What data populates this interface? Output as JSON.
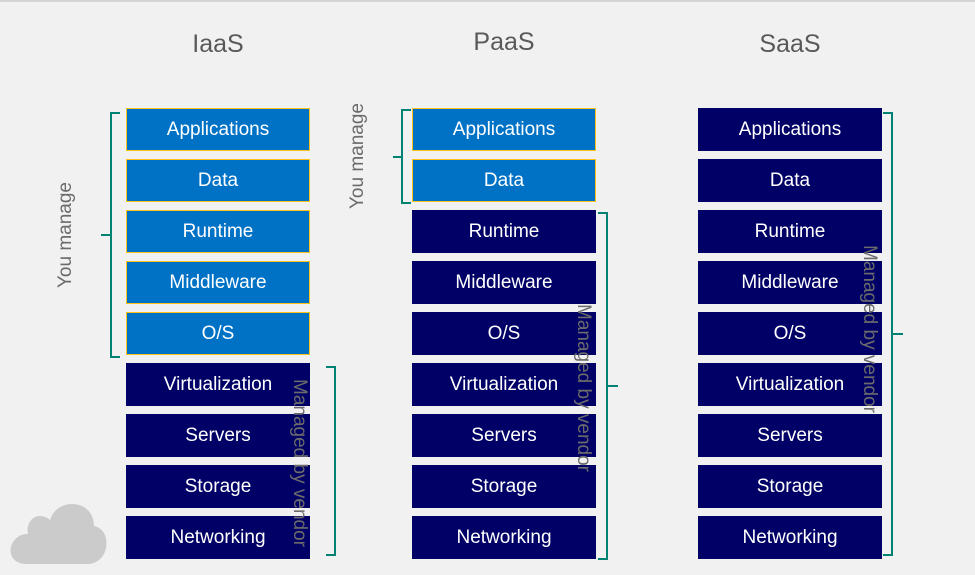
{
  "columns": [
    {
      "title": "IaaS",
      "layers": [
        {
          "label": "Applications",
          "managed_by": "you"
        },
        {
          "label": "Data",
          "managed_by": "you"
        },
        {
          "label": "Runtime",
          "managed_by": "you"
        },
        {
          "label": "Middleware",
          "managed_by": "you"
        },
        {
          "label": "O/S",
          "managed_by": "you"
        },
        {
          "label": "Virtualization",
          "managed_by": "vendor"
        },
        {
          "label": "Servers",
          "managed_by": "vendor"
        },
        {
          "label": "Storage",
          "managed_by": "vendor"
        },
        {
          "label": "Networking",
          "managed_by": "vendor"
        }
      ],
      "you_manage_label": "You manage",
      "vendor_label": "Managed by vendor"
    },
    {
      "title": "PaaS",
      "layers": [
        {
          "label": "Applications",
          "managed_by": "you"
        },
        {
          "label": "Data",
          "managed_by": "you"
        },
        {
          "label": "Runtime",
          "managed_by": "vendor"
        },
        {
          "label": "Middleware",
          "managed_by": "vendor"
        },
        {
          "label": "O/S",
          "managed_by": "vendor"
        },
        {
          "label": "Virtualization",
          "managed_by": "vendor"
        },
        {
          "label": "Servers",
          "managed_by": "vendor"
        },
        {
          "label": "Storage",
          "managed_by": "vendor"
        },
        {
          "label": "Networking",
          "managed_by": "vendor"
        }
      ],
      "you_manage_label": "You manage",
      "vendor_label": "Managed by vendor"
    },
    {
      "title": "SaaS",
      "layers": [
        {
          "label": "Applications",
          "managed_by": "vendor"
        },
        {
          "label": "Data",
          "managed_by": "vendor"
        },
        {
          "label": "Runtime",
          "managed_by": "vendor"
        },
        {
          "label": "Middleware",
          "managed_by": "vendor"
        },
        {
          "label": "O/S",
          "managed_by": "vendor"
        },
        {
          "label": "Virtualization",
          "managed_by": "vendor"
        },
        {
          "label": "Servers",
          "managed_by": "vendor"
        },
        {
          "label": "Storage",
          "managed_by": "vendor"
        },
        {
          "label": "Networking",
          "managed_by": "vendor"
        }
      ],
      "vendor_label": "Managed by vendor"
    }
  ],
  "colors": {
    "you_manage_fill": "#0072c6",
    "you_manage_border": "#ffc21a",
    "vendor_fill": "#000066",
    "bracket": "#008272",
    "label_text": "#6b6b6b"
  },
  "decorations": {
    "corner_icon": "cloud-icon"
  }
}
